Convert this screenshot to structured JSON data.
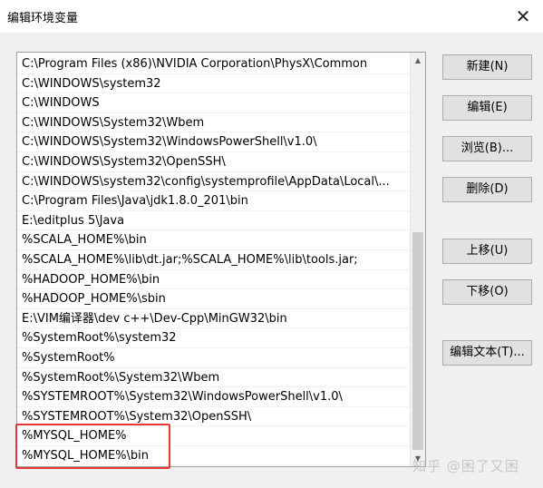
{
  "window": {
    "title": "编辑环境变量",
    "close_glyph": "✕"
  },
  "path_list": [
    "C:\\Program Files (x86)\\NVIDIA Corporation\\PhysX\\Common",
    "C:\\WINDOWS\\system32",
    "C:\\WINDOWS",
    "C:\\WINDOWS\\System32\\Wbem",
    "C:\\WINDOWS\\System32\\WindowsPowerShell\\v1.0\\",
    "C:\\WINDOWS\\System32\\OpenSSH\\",
    "C:\\WINDOWS\\system32\\config\\systemprofile\\AppData\\Local\\...",
    "C:\\Program Files\\Java\\jdk1.8.0_201\\bin",
    "E:\\editplus 5\\Java",
    "%SCALA_HOME%\\bin",
    "%SCALA_HOME%\\lib\\dt.jar;%SCALA_HOME%\\lib\\tools.jar;",
    "%HADOOP_HOME%\\bin",
    "%HADOOP_HOME%\\sbin",
    "E:\\VIM编译器\\dev c++\\Dev-Cpp\\MinGW32\\bin",
    "%SystemRoot%\\system32",
    "%SystemRoot%",
    "%SystemRoot%\\System32\\Wbem",
    "%SYSTEMROOT%\\System32\\WindowsPowerShell\\v1.0\\",
    "%SYSTEMROOT%\\System32\\OpenSSH\\",
    "%MYSQL_HOME%",
    "%MYSQL_HOME%\\bin"
  ],
  "buttons": {
    "new": "新建(N)",
    "edit": "编辑(E)",
    "browse": "浏览(B)...",
    "delete": "删除(D)",
    "move_up": "上移(U)",
    "move_down": "下移(O)",
    "edit_text": "编辑文本(T)..."
  },
  "watermark": "知乎 @困了又困",
  "colors": {
    "highlight_border": "#e53935"
  }
}
